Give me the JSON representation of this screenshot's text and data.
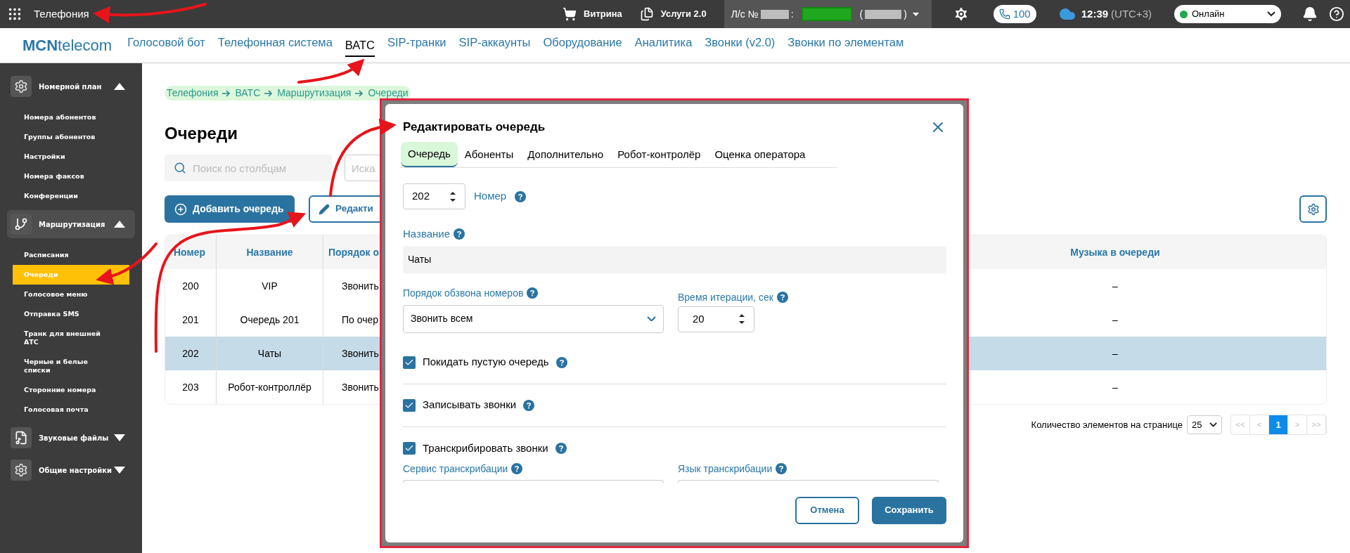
{
  "top_bar": {
    "app_title": "Телефония",
    "links": [
      {
        "kind": "cart",
        "label": "Витрина"
      },
      {
        "kind": "services",
        "label": "Услуги 2.0"
      }
    ],
    "account": {
      "label": "Л/с №",
      "separator": ":",
      "open_paren": "(",
      "close_paren": ")"
    },
    "calls_badge": "100",
    "time": "12:39",
    "timezone": "(UTC+3)",
    "status": {
      "label": "Онлайн",
      "color": "#22a94b"
    }
  },
  "nav": {
    "logo": "**MCN**telecom",
    "items": [
      {
        "label": "Голосовой бот",
        "selected": false
      },
      {
        "label": "Телефонная система",
        "selected": false
      },
      {
        "label": "ВАТС",
        "selected": true
      },
      {
        "label": "SIP-транки",
        "selected": false
      },
      {
        "label": "SIP-аккаунты",
        "selected": false
      },
      {
        "label": "Оборудование",
        "selected": false
      },
      {
        "label": "Аналитика",
        "selected": false
      },
      {
        "label": "Звонки (v2.0)",
        "selected": false
      },
      {
        "label": "Звонки по элементам",
        "selected": false
      }
    ]
  },
  "sidebar": {
    "groups": [
      {
        "kind": "gear",
        "title": "Номерной план",
        "expanded": true,
        "selected": false,
        "items": [
          {
            "label": "Номера абонентов",
            "selected": false
          },
          {
            "label": "Группы абонентов",
            "selected": false
          },
          {
            "label": "Настройки",
            "selected": false
          },
          {
            "label": "Номера факсов",
            "selected": false
          },
          {
            "label": "Конференции",
            "selected": false
          }
        ]
      },
      {
        "kind": "branch",
        "title": "Маршрутизация",
        "expanded": true,
        "selected": true,
        "items": [
          {
            "label": "Расписания",
            "selected": false
          },
          {
            "label": "Очереди",
            "selected": true
          },
          {
            "label": "Голосовое меню",
            "selected": false
          },
          {
            "label": "Отправка SMS",
            "selected": false
          },
          {
            "label": "Транк для внешней АТС",
            "selected": false
          },
          {
            "label": "Черные и белые списки",
            "selected": false
          },
          {
            "label": "Сторонние номера",
            "selected": false
          },
          {
            "label": "Голосовая почта",
            "selected": false
          }
        ]
      },
      {
        "kind": "music",
        "title": "Звуковые файлы",
        "expanded": false,
        "selected": false
      },
      {
        "kind": "gear",
        "title": "Общие настройки",
        "expanded": false,
        "selected": false
      }
    ]
  },
  "breadcrumb": {
    "highlighted": true,
    "items": [
      "Телефония",
      "ВАТС",
      "Маршрутизация",
      "Очереди"
    ]
  },
  "page_title": "Очереди",
  "search": {
    "placeholder": "Поиск по столбцам"
  },
  "search_2": {
    "placeholder": "Иска"
  },
  "buttons": [
    {
      "kind": "add",
      "label": "Добавить очередь"
    },
    {
      "kind": "edit",
      "label": "Редакти"
    }
  ],
  "table": {
    "columns": [
      "Номер",
      "Название",
      "Порядок о",
      "Музыка в очереди"
    ],
    "rows": [
      {
        "cells": [
          "200",
          "VIP",
          "Звонить",
          "–"
        ],
        "selected": false
      },
      {
        "cells": [
          "201",
          "Очередь 201",
          "По очер",
          "–"
        ],
        "selected": false
      },
      {
        "cells": [
          "202",
          "Чаты",
          "Звонить",
          "–"
        ],
        "selected": true
      },
      {
        "cells": [
          "203",
          "Робот-контроллёр",
          "Звонить",
          "–"
        ],
        "selected": false
      }
    ]
  },
  "pagination": {
    "label": "Количество элементов на странице",
    "page_size": "25",
    "pages": [
      {
        "label": "<<",
        "selected": false
      },
      {
        "label": "<",
        "selected": false
      },
      {
        "label": "1",
        "selected": true
      },
      {
        "label": ">",
        "selected": false
      },
      {
        "label": ">>",
        "selected": false
      }
    ]
  },
  "modal": {
    "title": "Редактировать очередь",
    "tabs": [
      {
        "label": "Очередь",
        "selected": true,
        "highlighted": true
      },
      {
        "label": "Абоненты",
        "selected": false,
        "highlighted": false
      },
      {
        "label": "Дополнительно",
        "selected": false,
        "highlighted": false
      },
      {
        "label": "Робот-контролёр",
        "selected": false,
        "highlighted": false
      },
      {
        "label": "Оценка оператора",
        "selected": false,
        "highlighted": false
      }
    ],
    "number": {
      "value": "202",
      "label": "Номер"
    },
    "name": {
      "label": "Название",
      "value": "Чаты"
    },
    "order": {
      "label": "Порядок обзвона номеров",
      "value": "Звонить всем"
    },
    "iteration": {
      "label": "Время итерации, сек",
      "value": "20"
    },
    "checkboxes": [
      {
        "label": "Покидать пустую очередь",
        "checked": true
      },
      {
        "label": "Записывать звонки",
        "checked": true
      },
      {
        "label": "Транскрибировать звонки",
        "checked": true
      }
    ],
    "transcription_fields": [
      {
        "label": "Сервис транскрибации"
      },
      {
        "label": "Язык транскрибации"
      }
    ],
    "buttons": [
      {
        "kind": "secondary",
        "label": "Отмена"
      },
      {
        "kind": "primary",
        "label": "Сохранить"
      }
    ]
  }
}
